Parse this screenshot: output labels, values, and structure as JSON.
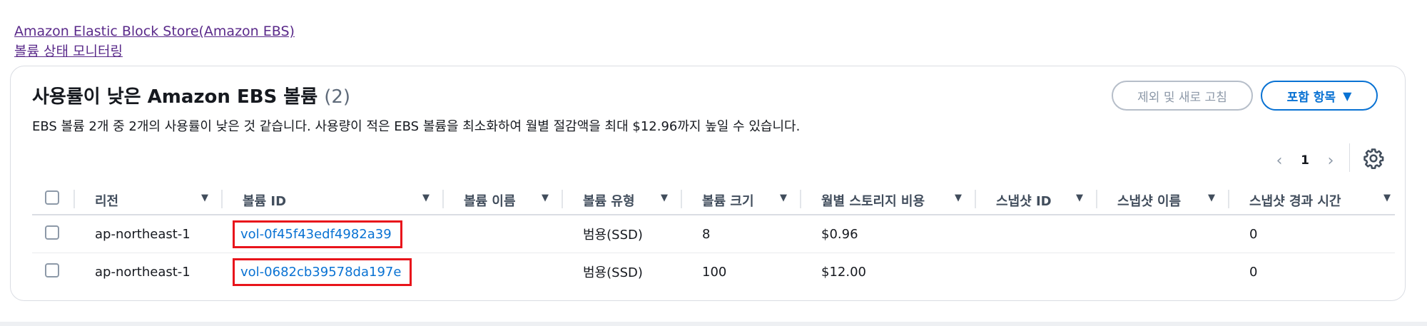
{
  "breadcrumbs": [
    "Amazon Elastic Block Store(Amazon EBS)",
    "볼륨 상태 모니터링"
  ],
  "panel": {
    "title": "사용률이 낮은 Amazon EBS 볼륨",
    "count": "(2)",
    "description": "EBS 볼륨 2개 중 2개의 사용률이 낮은 것 같습니다. 사용량이 적은 EBS 볼륨을 최소화하여 월별 절감액을 최대 $12.96까지 높일 수 있습니다.",
    "exclude_button": "제외 및 새로 고침",
    "include_button": "포함 항목"
  },
  "pagination": {
    "prev": "‹",
    "page": "1",
    "next": "›"
  },
  "icons": {
    "settings": "gear-icon",
    "sort": "caret-down-icon"
  },
  "colors": {
    "accent": "#0972d3",
    "highlight_box": "#e8141b"
  },
  "table": {
    "columns": [
      "리전",
      "볼륨 ID",
      "볼륨 이름",
      "볼륨 유형",
      "볼륨 크기",
      "월별 스토리지 비용",
      "스냅샷 ID",
      "스냅샷 이름",
      "스냅샷 경과 시간"
    ],
    "rows": [
      {
        "region": "ap-northeast-1",
        "volume_id": "vol-0f45f43edf4982a39",
        "volume_name": "",
        "volume_type": "범용(SSD)",
        "size": "8",
        "cost": "$0.96",
        "snapshot_id": "",
        "snapshot_name": "",
        "snapshot_age": "0"
      },
      {
        "region": "ap-northeast-1",
        "volume_id": "vol-0682cb39578da197e",
        "volume_name": "",
        "volume_type": "범용(SSD)",
        "size": "100",
        "cost": "$12.00",
        "snapshot_id": "",
        "snapshot_name": "",
        "snapshot_age": "0"
      }
    ]
  }
}
